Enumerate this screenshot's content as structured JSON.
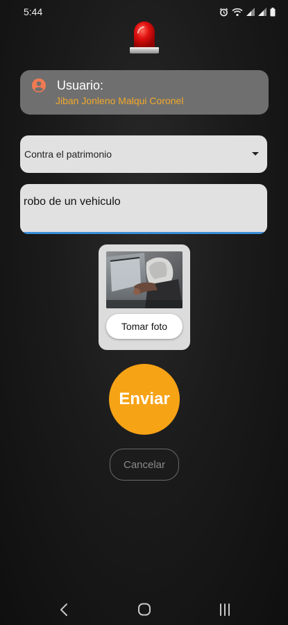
{
  "status_bar": {
    "time": "5:44",
    "icons": [
      "alarm-icon",
      "wifi-icon",
      "signal-icon",
      "signal-icon",
      "battery-icon"
    ]
  },
  "header": {
    "icon": "siren-icon",
    "colors": {
      "light": "#e01010",
      "base": "#c9c9c9"
    }
  },
  "user_card": {
    "icon": "person-circle-icon",
    "label": "Usuario:",
    "name": "Jiban Jonleno Malqui Coronel",
    "colors": {
      "icon": "#f07a52",
      "name": "#f3a92b"
    }
  },
  "form": {
    "category": {
      "selected": "Contra el patrimonio",
      "icon": "dropdown-arrow-icon"
    },
    "description": {
      "value": "robo de un vehiculo",
      "underline_color": "#3a8ed8"
    },
    "photo": {
      "button_label": "Tomar foto"
    },
    "send_label": "Enviar",
    "cancel_label": "Cancelar",
    "colors": {
      "send": "#f7a316"
    }
  },
  "nav_bar": {
    "items": [
      "back-icon",
      "home-icon",
      "recents-icon"
    ]
  }
}
